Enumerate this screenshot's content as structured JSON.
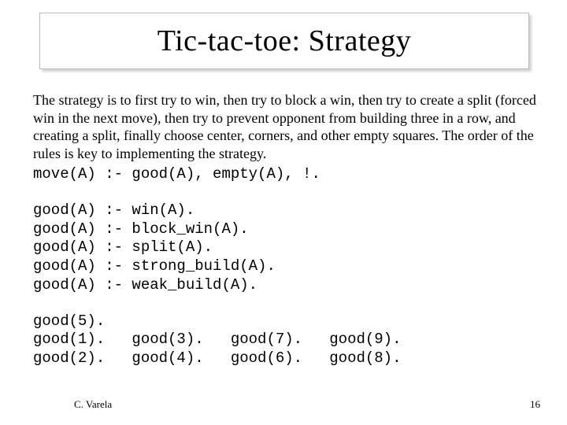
{
  "title": "Tic-tac-toe:  Strategy",
  "description": "The strategy is to first try to win, then try to block a win, then try to create a split (forced win in the next move), then try to prevent opponent from building three in a row, and creating a split, finally choose center, corners, and other empty squares.  The order of the rules is key to implementing the strategy.",
  "code_move": "move(A) :- good(A), empty(A), !.",
  "code_good_rules": "good(A) :- win(A).\ngood(A) :- block_win(A).\ngood(A) :- split(A).\ngood(A) :- strong_build(A).\ngood(A) :- weak_build(A).",
  "code_good_facts": "good(5).\ngood(1).   good(3).   good(7).   good(9).\ngood(2).   good(4).   good(6).   good(8).",
  "footer": {
    "author": "C. Varela",
    "page_number": "16"
  }
}
